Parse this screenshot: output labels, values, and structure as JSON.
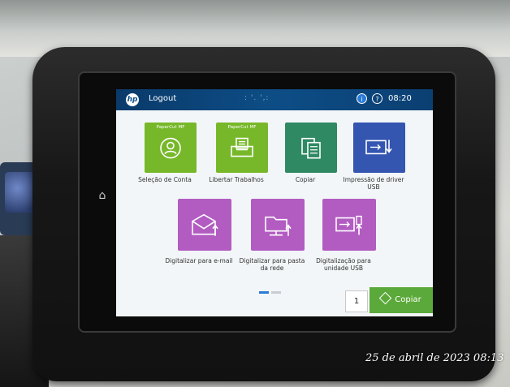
{
  "screen": {
    "header": {
      "logo": "hp",
      "logout_label": "Logout",
      "center_text": ": '. ',:",
      "info_icon": "i",
      "help_icon": "?",
      "time": "08:20"
    },
    "tiles": [
      {
        "label": "Seleção de Conta",
        "brand": "PaperCut MF",
        "icon": "user-icon",
        "color": "#77b82a"
      },
      {
        "label": "Libertar Trabalhos",
        "brand": "PaperCut MF",
        "icon": "tray-icon",
        "color": "#77b82a"
      },
      {
        "label": "Copiar",
        "icon": "copy-icon",
        "color": "#2f8a63"
      },
      {
        "label": "Impressão de driver USB",
        "icon": "usb-print-icon",
        "color": "#3455b0"
      },
      {
        "label": "Digitalizar para e-mail",
        "icon": "envelope-icon",
        "color": "#b25cc2"
      },
      {
        "label": "Digitalizar para pasta da rede",
        "icon": "network-folder-icon",
        "color": "#b25cc2"
      },
      {
        "label": "Digitalização para unidade USB",
        "icon": "usb-scan-icon",
        "color": "#b25cc2"
      }
    ],
    "pagination": {
      "current": 1,
      "total": 2
    },
    "copies_value": "1",
    "copy_button_label": "Copiar"
  },
  "timestamp": "25 de abril de 2023 08:13",
  "colors": {
    "header_blue": "#0d4d86",
    "papercut_green": "#77b82a",
    "copy_green": "#5ba93a",
    "scan_purple": "#b25cc2",
    "usb_blue": "#3455b0"
  }
}
